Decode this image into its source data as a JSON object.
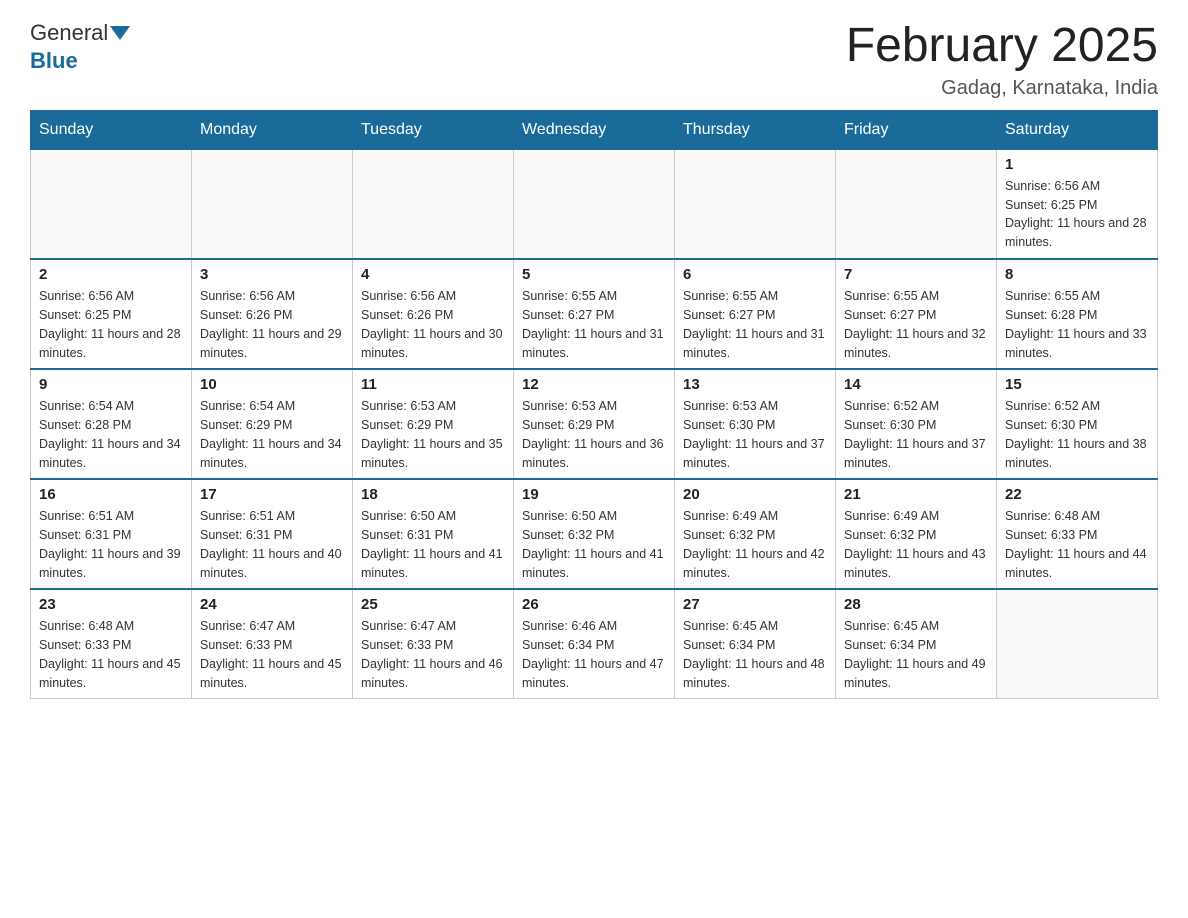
{
  "logo": {
    "general": "General",
    "blue": "Blue"
  },
  "title": "February 2025",
  "location": "Gadag, Karnataka, India",
  "days_of_week": [
    "Sunday",
    "Monday",
    "Tuesday",
    "Wednesday",
    "Thursday",
    "Friday",
    "Saturday"
  ],
  "weeks": [
    [
      {
        "day": "",
        "info": ""
      },
      {
        "day": "",
        "info": ""
      },
      {
        "day": "",
        "info": ""
      },
      {
        "day": "",
        "info": ""
      },
      {
        "day": "",
        "info": ""
      },
      {
        "day": "",
        "info": ""
      },
      {
        "day": "1",
        "info": "Sunrise: 6:56 AM\nSunset: 6:25 PM\nDaylight: 11 hours and 28 minutes."
      }
    ],
    [
      {
        "day": "2",
        "info": "Sunrise: 6:56 AM\nSunset: 6:25 PM\nDaylight: 11 hours and 28 minutes."
      },
      {
        "day": "3",
        "info": "Sunrise: 6:56 AM\nSunset: 6:26 PM\nDaylight: 11 hours and 29 minutes."
      },
      {
        "day": "4",
        "info": "Sunrise: 6:56 AM\nSunset: 6:26 PM\nDaylight: 11 hours and 30 minutes."
      },
      {
        "day": "5",
        "info": "Sunrise: 6:55 AM\nSunset: 6:27 PM\nDaylight: 11 hours and 31 minutes."
      },
      {
        "day": "6",
        "info": "Sunrise: 6:55 AM\nSunset: 6:27 PM\nDaylight: 11 hours and 31 minutes."
      },
      {
        "day": "7",
        "info": "Sunrise: 6:55 AM\nSunset: 6:27 PM\nDaylight: 11 hours and 32 minutes."
      },
      {
        "day": "8",
        "info": "Sunrise: 6:55 AM\nSunset: 6:28 PM\nDaylight: 11 hours and 33 minutes."
      }
    ],
    [
      {
        "day": "9",
        "info": "Sunrise: 6:54 AM\nSunset: 6:28 PM\nDaylight: 11 hours and 34 minutes."
      },
      {
        "day": "10",
        "info": "Sunrise: 6:54 AM\nSunset: 6:29 PM\nDaylight: 11 hours and 34 minutes."
      },
      {
        "day": "11",
        "info": "Sunrise: 6:53 AM\nSunset: 6:29 PM\nDaylight: 11 hours and 35 minutes."
      },
      {
        "day": "12",
        "info": "Sunrise: 6:53 AM\nSunset: 6:29 PM\nDaylight: 11 hours and 36 minutes."
      },
      {
        "day": "13",
        "info": "Sunrise: 6:53 AM\nSunset: 6:30 PM\nDaylight: 11 hours and 37 minutes."
      },
      {
        "day": "14",
        "info": "Sunrise: 6:52 AM\nSunset: 6:30 PM\nDaylight: 11 hours and 37 minutes."
      },
      {
        "day": "15",
        "info": "Sunrise: 6:52 AM\nSunset: 6:30 PM\nDaylight: 11 hours and 38 minutes."
      }
    ],
    [
      {
        "day": "16",
        "info": "Sunrise: 6:51 AM\nSunset: 6:31 PM\nDaylight: 11 hours and 39 minutes."
      },
      {
        "day": "17",
        "info": "Sunrise: 6:51 AM\nSunset: 6:31 PM\nDaylight: 11 hours and 40 minutes."
      },
      {
        "day": "18",
        "info": "Sunrise: 6:50 AM\nSunset: 6:31 PM\nDaylight: 11 hours and 41 minutes."
      },
      {
        "day": "19",
        "info": "Sunrise: 6:50 AM\nSunset: 6:32 PM\nDaylight: 11 hours and 41 minutes."
      },
      {
        "day": "20",
        "info": "Sunrise: 6:49 AM\nSunset: 6:32 PM\nDaylight: 11 hours and 42 minutes."
      },
      {
        "day": "21",
        "info": "Sunrise: 6:49 AM\nSunset: 6:32 PM\nDaylight: 11 hours and 43 minutes."
      },
      {
        "day": "22",
        "info": "Sunrise: 6:48 AM\nSunset: 6:33 PM\nDaylight: 11 hours and 44 minutes."
      }
    ],
    [
      {
        "day": "23",
        "info": "Sunrise: 6:48 AM\nSunset: 6:33 PM\nDaylight: 11 hours and 45 minutes."
      },
      {
        "day": "24",
        "info": "Sunrise: 6:47 AM\nSunset: 6:33 PM\nDaylight: 11 hours and 45 minutes."
      },
      {
        "day": "25",
        "info": "Sunrise: 6:47 AM\nSunset: 6:33 PM\nDaylight: 11 hours and 46 minutes."
      },
      {
        "day": "26",
        "info": "Sunrise: 6:46 AM\nSunset: 6:34 PM\nDaylight: 11 hours and 47 minutes."
      },
      {
        "day": "27",
        "info": "Sunrise: 6:45 AM\nSunset: 6:34 PM\nDaylight: 11 hours and 48 minutes."
      },
      {
        "day": "28",
        "info": "Sunrise: 6:45 AM\nSunset: 6:34 PM\nDaylight: 11 hours and 49 minutes."
      },
      {
        "day": "",
        "info": ""
      }
    ]
  ]
}
